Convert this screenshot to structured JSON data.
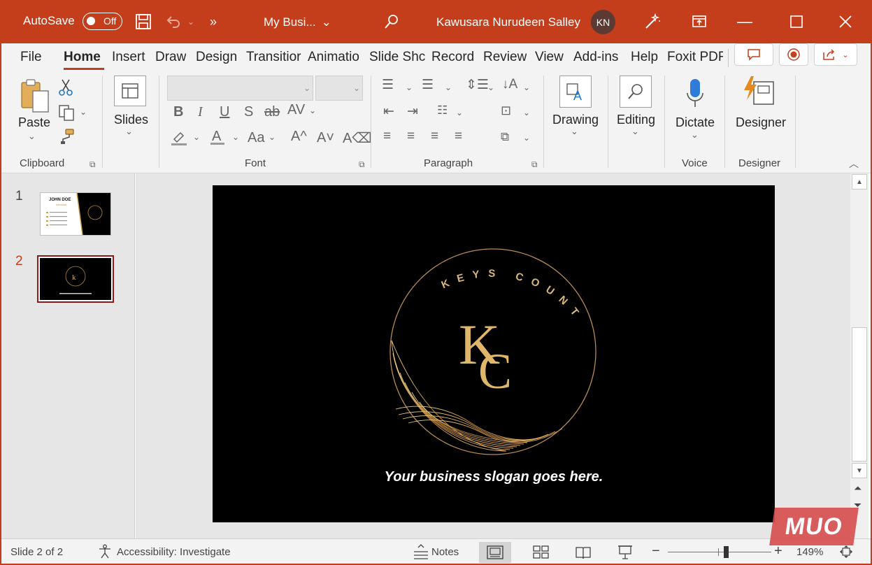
{
  "titlebar": {
    "autosave_label": "AutoSave",
    "autosave_state": "Off",
    "doc_title": "My Busi...",
    "user_name": "Kawusara Nurudeen Salley",
    "avatar_initials": "KN",
    "accent": "#c43e1c"
  },
  "tabs": [
    "File",
    "Home",
    "Insert",
    "Draw",
    "Design",
    "Transitior",
    "Animatio",
    "Slide Shc",
    "Record",
    "Review",
    "View",
    "Add-ins",
    "Help",
    "Foxit PDF"
  ],
  "active_tab": "Home",
  "ribbon": {
    "clipboard": {
      "paste_label": "Paste",
      "group_label": "Clipboard"
    },
    "slides": {
      "label": "Slides"
    },
    "font": {
      "group_label": "Font"
    },
    "paragraph": {
      "group_label": "Paragraph"
    },
    "drawing": {
      "label": "Drawing"
    },
    "editing": {
      "label": "Editing"
    },
    "voice": {
      "dictate_label": "Dictate",
      "group_label": "Voice"
    },
    "designer": {
      "label": "Designer",
      "group_label": "Designer"
    }
  },
  "thumbnails": [
    {
      "number": "1",
      "title": "JOHN DOE",
      "subtitle": "MANAGER"
    },
    {
      "number": "2"
    }
  ],
  "slide": {
    "arc_text": "KEYS COUNT",
    "monogram_k": "K",
    "monogram_c": "C",
    "slogan": "Your business slogan goes here."
  },
  "statusbar": {
    "slide_info": "Slide 2 of 2",
    "accessibility": "Accessibility: Investigate",
    "notes_label": "Notes",
    "zoom_level": "149%"
  },
  "watermark": "MUO"
}
